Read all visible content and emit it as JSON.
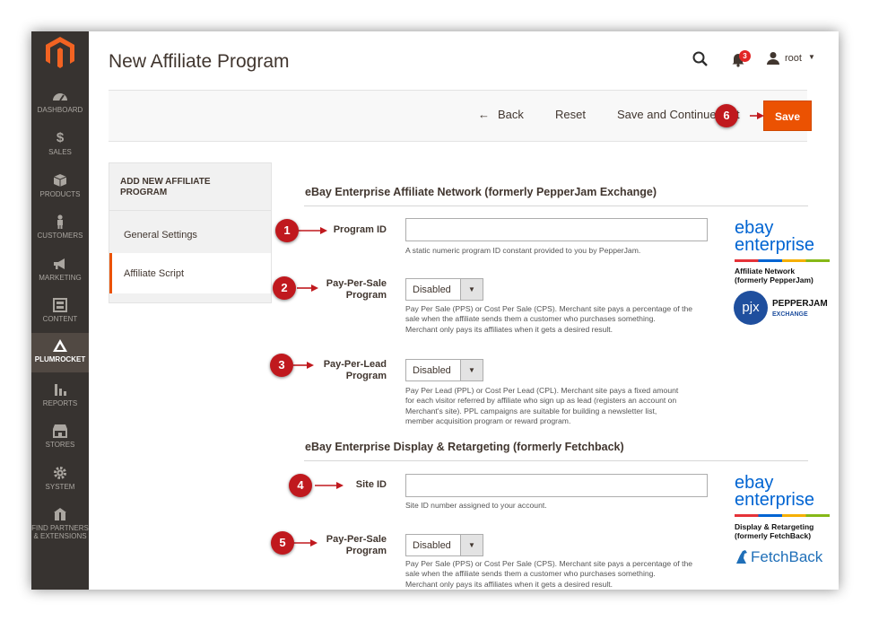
{
  "sidebar": {
    "items": [
      {
        "label": "DASHBOARD",
        "icon": "dashboard-icon"
      },
      {
        "label": "SALES",
        "icon": "dollar-icon"
      },
      {
        "label": "PRODUCTS",
        "icon": "box-icon"
      },
      {
        "label": "CUSTOMERS",
        "icon": "person-icon"
      },
      {
        "label": "MARKETING",
        "icon": "megaphone-icon"
      },
      {
        "label": "CONTENT",
        "icon": "layout-icon"
      },
      {
        "label": "PLUMROCKET",
        "icon": "plumrocket-icon"
      },
      {
        "label": "REPORTS",
        "icon": "bar-chart-icon"
      },
      {
        "label": "STORES",
        "icon": "store-icon"
      },
      {
        "label": "SYSTEM",
        "icon": "gear-icon"
      },
      {
        "label1": "FIND PARTNERS",
        "label2": "& EXTENSIONS",
        "icon": "partners-icon"
      }
    ]
  },
  "header": {
    "title": "New Affiliate Program",
    "notif_count": "3",
    "user": "root"
  },
  "actions": {
    "back": "Back",
    "reset": "Reset",
    "save_continue": "Save and Continue Edit",
    "save": "Save"
  },
  "tabs": {
    "heading_line1": "ADD NEW AFFILIATE",
    "heading_line2": "PROGRAM",
    "general": "General Settings",
    "script": "Affiliate Script"
  },
  "section1": {
    "title": "eBay Enterprise Affiliate Network (formerly PepperJam Exchange)",
    "program_id_label": "Program ID",
    "program_id_note": "A static numeric program ID constant provided to you by PepperJam.",
    "pps_label1": "Pay-Per-Sale",
    "pps_label2": "Program",
    "pps_value": "Disabled",
    "pps_note1": "Pay Per Sale (PPS) or Cost Per Sale (CPS). Merchant site pays a percentage of the",
    "pps_note2": "sale when the affiliate sends them a customer who purchases something.",
    "pps_note3": "Merchant only pays its affiliates when it gets a desired result.",
    "ppl_label1": "Pay-Per-Lead",
    "ppl_label2": "Program",
    "ppl_value": "Disabled",
    "ppl_note1": "Pay Per Lead (PPL) or Cost Per Lead (CPL). Merchant site pays a fixed amount",
    "ppl_note2": "for each visitor referred by affiliate who sign up as lead (registers an account on",
    "ppl_note3": "Merchant's site). PPL campaigns are suitable for building a newsletter list,",
    "ppl_note4": "member acquisition program or reward program."
  },
  "section2": {
    "title": "eBay Enterprise Display & Retargeting (formerly Fetchback)",
    "site_id_label": "Site ID",
    "site_id_note": "Site ID number assigned to your account.",
    "pps_label1": "Pay-Per-Sale",
    "pps_label2": "Program",
    "pps_value": "Disabled",
    "pps_note1": "Pay Per Sale (PPS) or Cost Per Sale (CPS). Merchant site pays a percentage of the",
    "pps_note2": "sale when the affiliate sends them a customer who purchases something.",
    "pps_note3": "Merchant only pays its affiliates when it gets a desired result."
  },
  "callouts": [
    "1",
    "2",
    "3",
    "4",
    "5",
    "6"
  ],
  "logos": {
    "ebay": "ebay",
    "enterprise": "enterprise",
    "affnet1": "Affiliate Network",
    "affnet2": "(formerly PepperJam)",
    "pjx": "pjx",
    "pepperjam": "PEPPERJAM",
    "exchange": "EXCHANGE",
    "disp1": "Display & Retargeting",
    "disp2": "(formerly FetchBack)",
    "fetchback": "FetchBack"
  },
  "colors": {
    "accent": "#eb5202",
    "callout": "#c0191e",
    "sidebar": "#373330",
    "ebay_blue": "#0064d2"
  }
}
